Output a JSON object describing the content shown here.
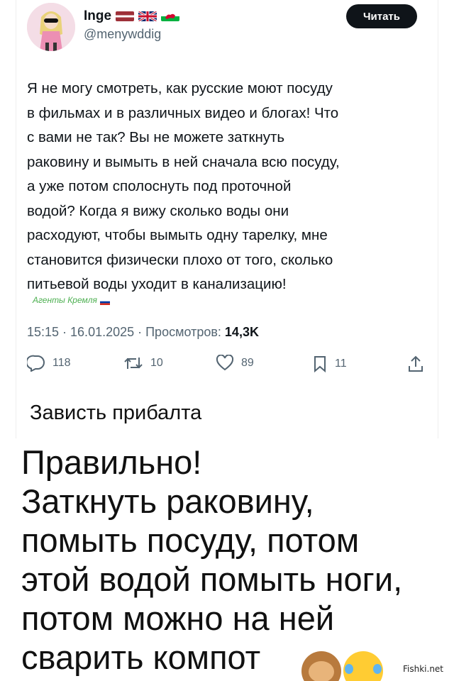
{
  "tweet": {
    "author_name": "Inge",
    "handle": "@menywddig",
    "follow_label": "Читать",
    "text_lines": [
      "Я не могу смотреть, как русские моют посуду",
      "в фильмах и в различных видео и блогах! Что",
      "с вами не так? Вы не можете заткнуть",
      "раковину и вымыть в ней сначала всю посуду,",
      "а уже потом сполоснуть под проточной",
      "водой? Когда я вижу сколько воды они",
      "расходуют, чтобы вымыть одну тарелку, мне",
      "становится физически плохо от того, сколько",
      "питьевой воды уходит в канализацию!"
    ],
    "watermark": "Агенты Кремля",
    "timestamp": "15:15 · 16.01.2025 · Просмотров:",
    "views": "14,3K",
    "actions": {
      "replies": "118",
      "reposts": "10",
      "likes": "89",
      "bookmarks": "11"
    }
  },
  "caption": "Зависть прибалта",
  "comment_lines": [
    "Правильно!",
    "Заткнуть раковину,",
    "помыть посуду, потом",
    "этой водой помыть ноги,",
    "потом можно на ней",
    "сварить компот"
  ],
  "site_mark": "Fishki.net",
  "colors": {
    "text": "#0f1419",
    "muted": "#536471",
    "button_bg": "#0f1419"
  }
}
